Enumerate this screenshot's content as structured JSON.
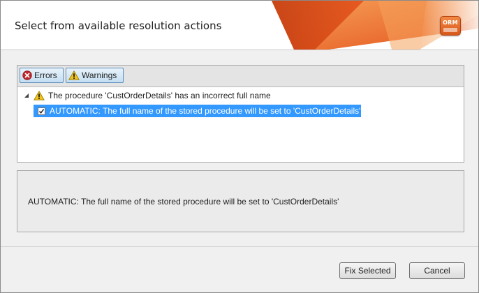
{
  "dialog": {
    "title": "Select from available resolution actions",
    "logo_text": "ORM"
  },
  "filters": {
    "errors_label": "Errors",
    "warnings_label": "Warnings"
  },
  "tree": {
    "issue": {
      "icon": "warning-icon",
      "text": "The procedure 'CustOrderDetails' has an incorrect full name",
      "expanded": true
    },
    "action": {
      "checked": true,
      "text": "AUTOMATIC: The full name of the stored procedure will be set to 'CustOrderDetails'"
    }
  },
  "details": {
    "text": "AUTOMATIC: The full name of the stored procedure will be set to 'CustOrderDetails'"
  },
  "buttons": {
    "fix_selected": "Fix Selected",
    "cancel": "Cancel"
  },
  "colors": {
    "accent": "#e8581c",
    "selection": "#3399ff",
    "error": "#c0292c",
    "warning": "#f2c318"
  }
}
